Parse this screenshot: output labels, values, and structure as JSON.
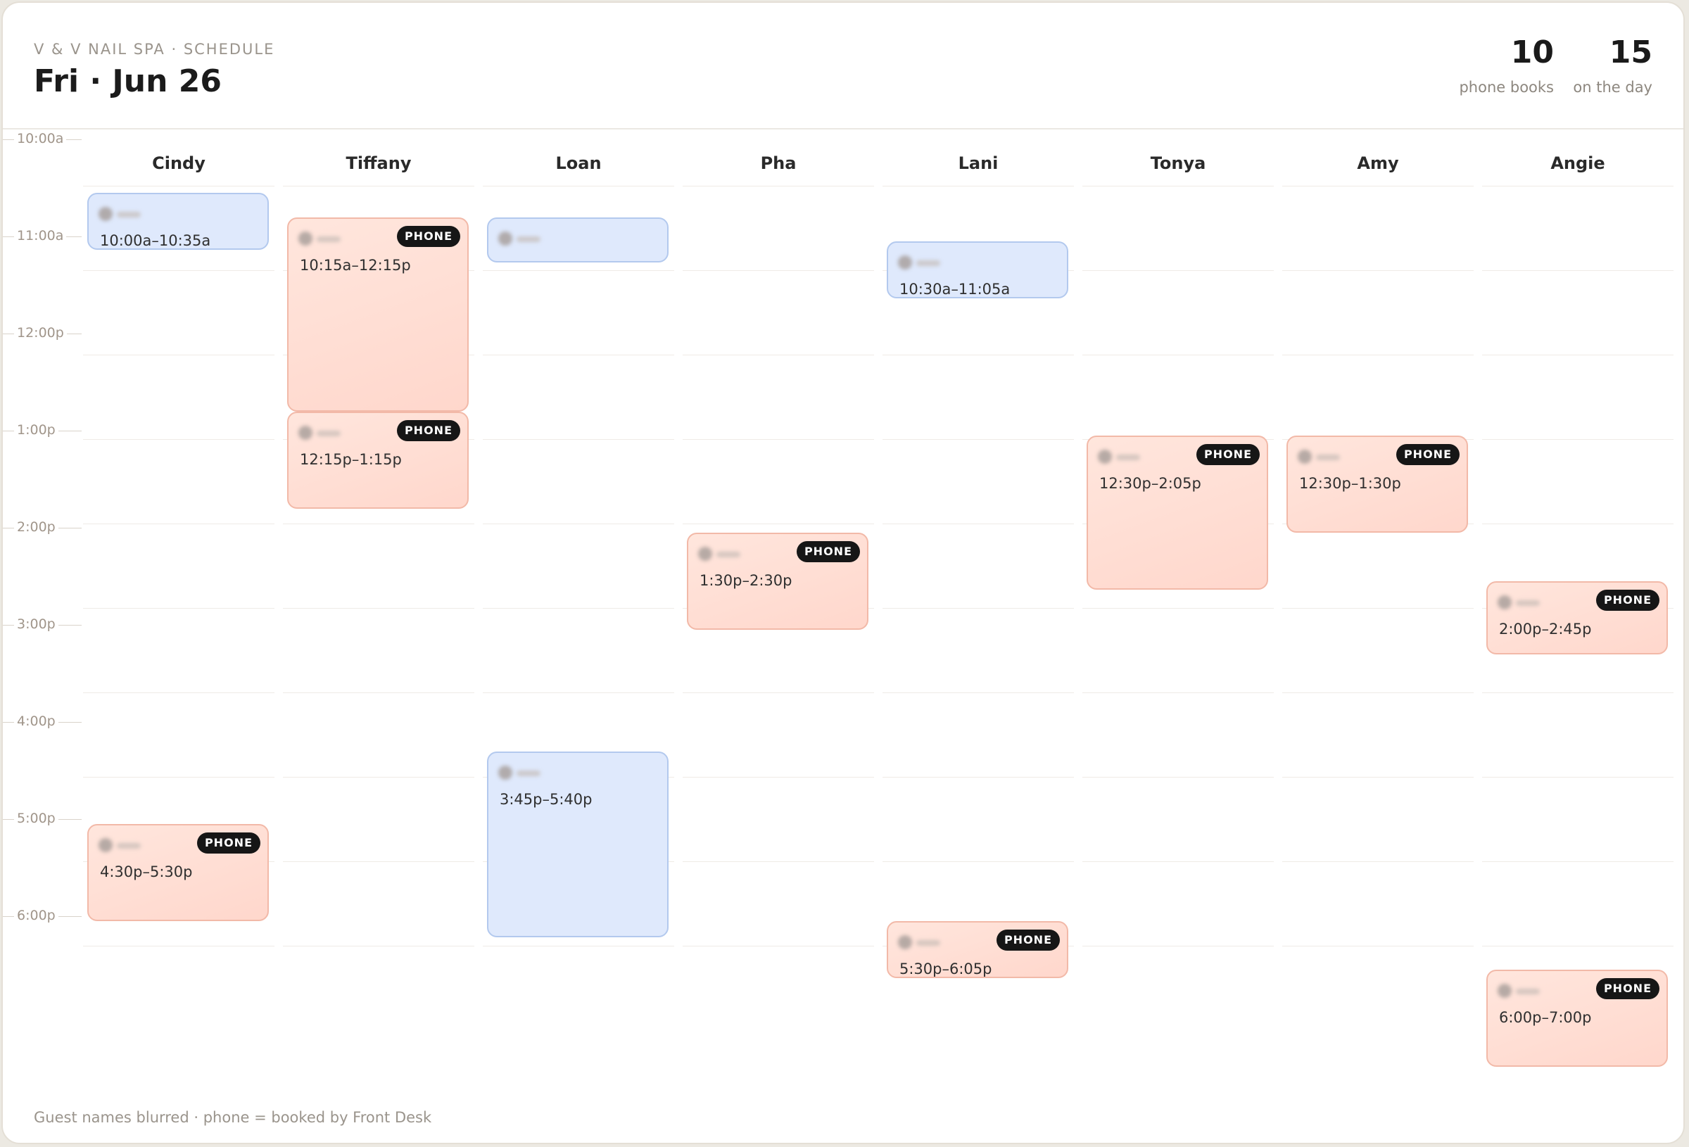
{
  "header": {
    "brand": "V & V NAIL SPA · SCHEDULE",
    "date": "Fri · Jun 26",
    "stats": [
      {
        "value": "10",
        "label": "phone books"
      },
      {
        "value": "15",
        "label": "on the day"
      }
    ]
  },
  "time_labels": [
    "10:00a",
    "11:00a",
    "12:00p",
    "1:00p",
    "2:00p",
    "3:00p",
    "4:00p",
    "5:00p",
    "6:00p"
  ],
  "badge_label": "PHONE",
  "staff": [
    {
      "name": "Cindy",
      "appointments": [
        {
          "time": "10:00a–10:35a",
          "phone": false
        },
        {
          "time": "4:30p–5:30p",
          "phone": true
        }
      ]
    },
    {
      "name": "Tiffany",
      "appointments": [
        {
          "time": "10:15a–12:15p",
          "phone": true
        },
        {
          "time": "12:15p–1:15p",
          "phone": true
        }
      ]
    },
    {
      "name": "Loan",
      "appointments": [
        {
          "time": "",
          "phone": false
        },
        {
          "time": "3:45p–5:40p",
          "phone": false
        }
      ]
    },
    {
      "name": "Pha",
      "appointments": [
        {
          "time": "1:30p–2:30p",
          "phone": true
        }
      ]
    },
    {
      "name": "Lani",
      "appointments": [
        {
          "time": "10:30a–11:05a",
          "phone": false
        },
        {
          "time": "5:30p–6:05p",
          "phone": true
        }
      ]
    },
    {
      "name": "Tonya",
      "appointments": [
        {
          "time": "12:30p–2:05p",
          "phone": true
        }
      ]
    },
    {
      "name": "Amy",
      "appointments": [
        {
          "time": "12:30p–1:30p",
          "phone": true
        }
      ]
    },
    {
      "name": "Angie",
      "appointments": [
        {
          "time": "2:00p–2:45p",
          "phone": true
        },
        {
          "time": "6:00p–7:00p",
          "phone": true
        }
      ]
    }
  ],
  "footer": "Guest names blurred · phone = booked by Front Desk",
  "colors": {
    "phone_fill": "#ffdcd1",
    "phone_border": "#f2b9a8",
    "walkin_fill": "#dfe9fc",
    "walkin_border": "#b3c9ee",
    "badge": "#161616"
  }
}
